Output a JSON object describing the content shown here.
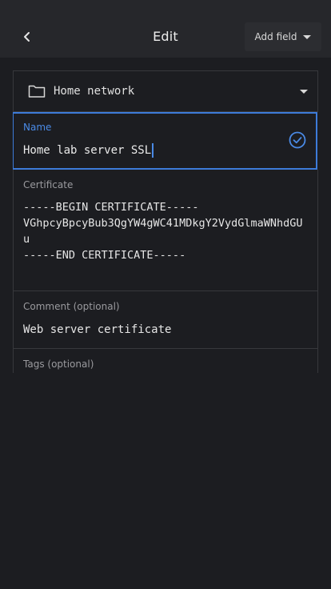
{
  "header": {
    "title": "Edit",
    "add_field_label": "Add field"
  },
  "folder": {
    "label": "Home network"
  },
  "fields": {
    "name": {
      "label": "Name",
      "value": "Home lab server SSL"
    },
    "certificate": {
      "label": "Certificate",
      "value": "-----BEGIN CERTIFICATE-----\nVGhpcyBpcyBub3QgYW4gWC41MDkgY2VydGlmaWNhdGUu\n-----END CERTIFICATE-----"
    },
    "comment": {
      "label": "Comment (optional)",
      "value": "Web server certificate"
    },
    "tags": {
      "label": "Tags (optional)"
    }
  },
  "colors": {
    "background": "#1c1d21",
    "topbar": "#26272b",
    "accent": "#3d7bd9",
    "border": "#37383c"
  },
  "icons": [
    "back-icon",
    "chevron-down-icon",
    "folder-icon",
    "check-circle-icon"
  ]
}
